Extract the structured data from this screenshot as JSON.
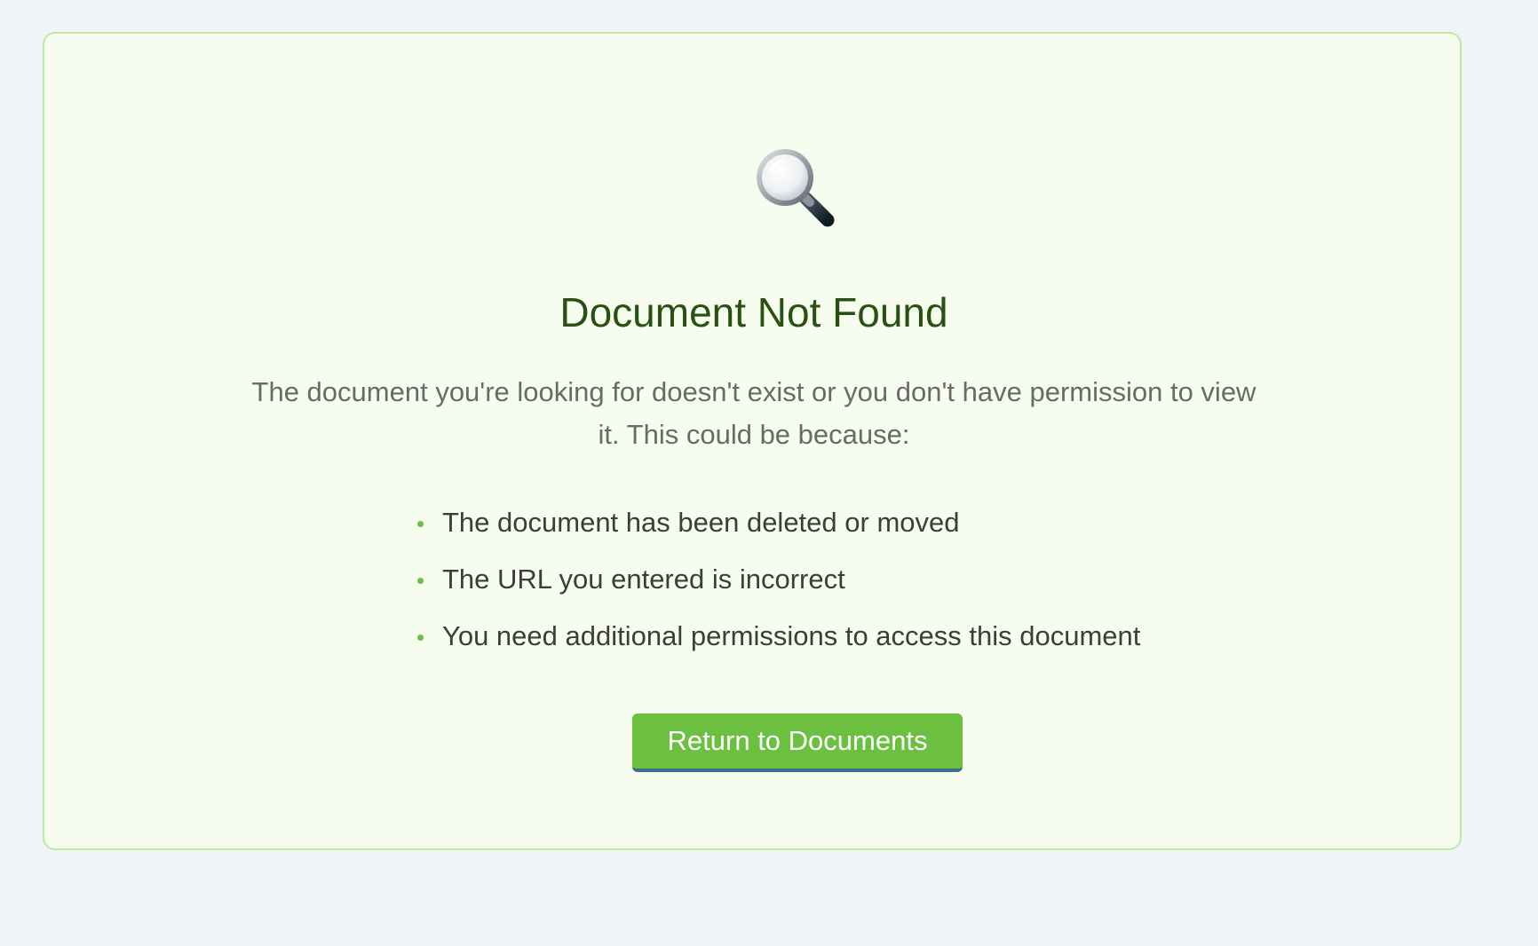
{
  "error": {
    "icon": "magnifying-glass-icon",
    "title": "Document Not Found",
    "description": "The document you're looking for doesn't exist or you don't have permission to view it. This could be because:",
    "reasons": [
      "The document has been deleted or moved",
      "The URL you entered is incorrect",
      "You need additional permissions to access this document"
    ],
    "button_label": "Return to Documents"
  },
  "colors": {
    "page_background": "#f1f5f9",
    "card_background": "#f6fdee",
    "card_border": "#bfe8a4",
    "title": "#2a5114",
    "accent": "#6cc040"
  }
}
